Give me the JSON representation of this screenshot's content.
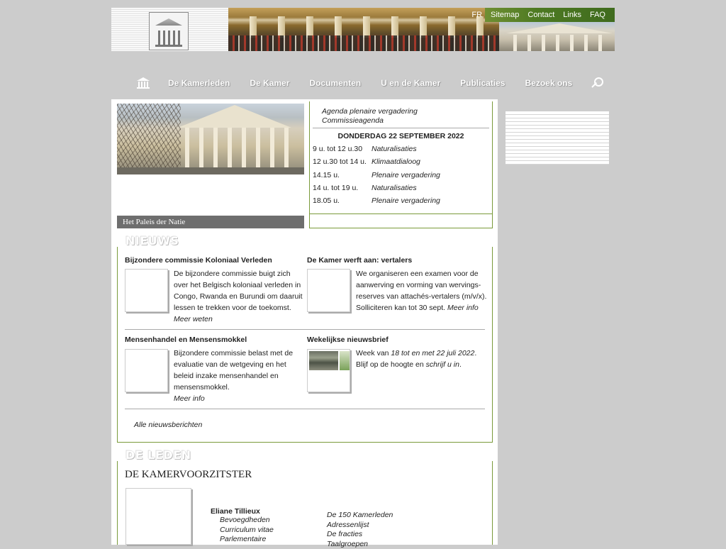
{
  "top_nav": [
    "FR",
    "Sitemap",
    "Contact",
    "Links",
    "FAQ"
  ],
  "main_nav": [
    "De Kamerleden",
    "De Kamer",
    "Documenten",
    "U en de Kamer",
    "Publicaties",
    "Bezoek ons"
  ],
  "photo_caption": "Het Paleis der Natie",
  "agenda": {
    "links": [
      "Agenda plenaire vergadering",
      "Commissieagenda"
    ],
    "date": "DONDERDAG 22 SEPTEMBER 2022",
    "items": [
      {
        "time": "9 u. tot 12 u.30",
        "title": "Naturalisaties"
      },
      {
        "time": "12 u.30 tot 14 u.",
        "title": "Klimaatdialoog"
      },
      {
        "time": "14.15 u.",
        "title": "Plenaire vergadering"
      },
      {
        "time": "14 u. tot 19 u.",
        "title": "Naturalisaties"
      },
      {
        "time": "18.05 u.",
        "title": "Plenaire vergadering"
      }
    ]
  },
  "news": {
    "heading": "NIEUWS",
    "items": [
      {
        "title": "Bijzondere commissie Koloniaal Verleden",
        "text": "De bijzondere commissie buigt zich over het Belgisch koloniaal verleden in Congo, Rwanda en Burundi om daaruit lessen te trekken voor de toekomst.",
        "link": "Meer weten"
      },
      {
        "title": "De Kamer werft aan: vertalers",
        "text": "We organiseren een examen voor de aanwerving en vorming van wervings-reserves van attachés-vertalers (m/v/x). Solliciteren kan tot 30 sept.",
        "link": "Meer info"
      },
      {
        "title": "Mensenhandel en Mensensmokkel",
        "text": "Bijzondere commissie belast met de evaluatie van de wetgeving en het beleid inzake mensenhandel en mensensmokkel.",
        "link": "Meer info"
      },
      {
        "title": "Wekelijkse nieuwsbrief",
        "text_before": "Week van",
        "week_link": "18 tot en met 22 juli 2022",
        "text_middle": ". Blijf op de hoogte en",
        "subscribe_link": "schrijf u in",
        "text_after": "."
      }
    ],
    "all_link": "Alle nieuwsberichten"
  },
  "leden": {
    "heading": "DE LEDEN",
    "voorzitter_title": "DE KAMERVOORZITSTER",
    "name": "Eliane Tillieux",
    "voorzitter_links": [
      "Bevoegdheden",
      "Curriculum vitae",
      "Parlementaire"
    ],
    "member_links": [
      "De 150 Kamerleden",
      "Adressenlijst",
      "De fracties",
      "Taalgroepen"
    ]
  },
  "colors": {
    "accent_green": "#5a7f2a",
    "frame_green": "#7a9a3a",
    "page_bg": "#cccccc"
  },
  "icons": [
    "home-icon",
    "search-icon"
  ]
}
